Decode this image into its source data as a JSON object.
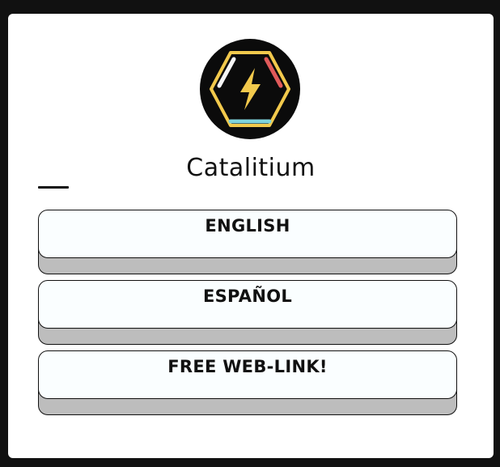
{
  "profile": {
    "name": "Catalitium",
    "logo_icon": "lightning-hexagon-icon",
    "colors": {
      "logo_bg": "#0b0b0b",
      "hexagon": "#f2c94c",
      "bolt": "#f2c94c",
      "accent_red": "#e05a5a",
      "accent_cyan": "#7fd3dc",
      "accent_white": "#f5f5f5",
      "button_face": "#fafeff",
      "button_shadow": "#bdbdbd"
    }
  },
  "links": [
    {
      "label": "ENGLISH"
    },
    {
      "label": "ESPAÑOL"
    },
    {
      "label": "FREE WEB-LINK!"
    }
  ]
}
